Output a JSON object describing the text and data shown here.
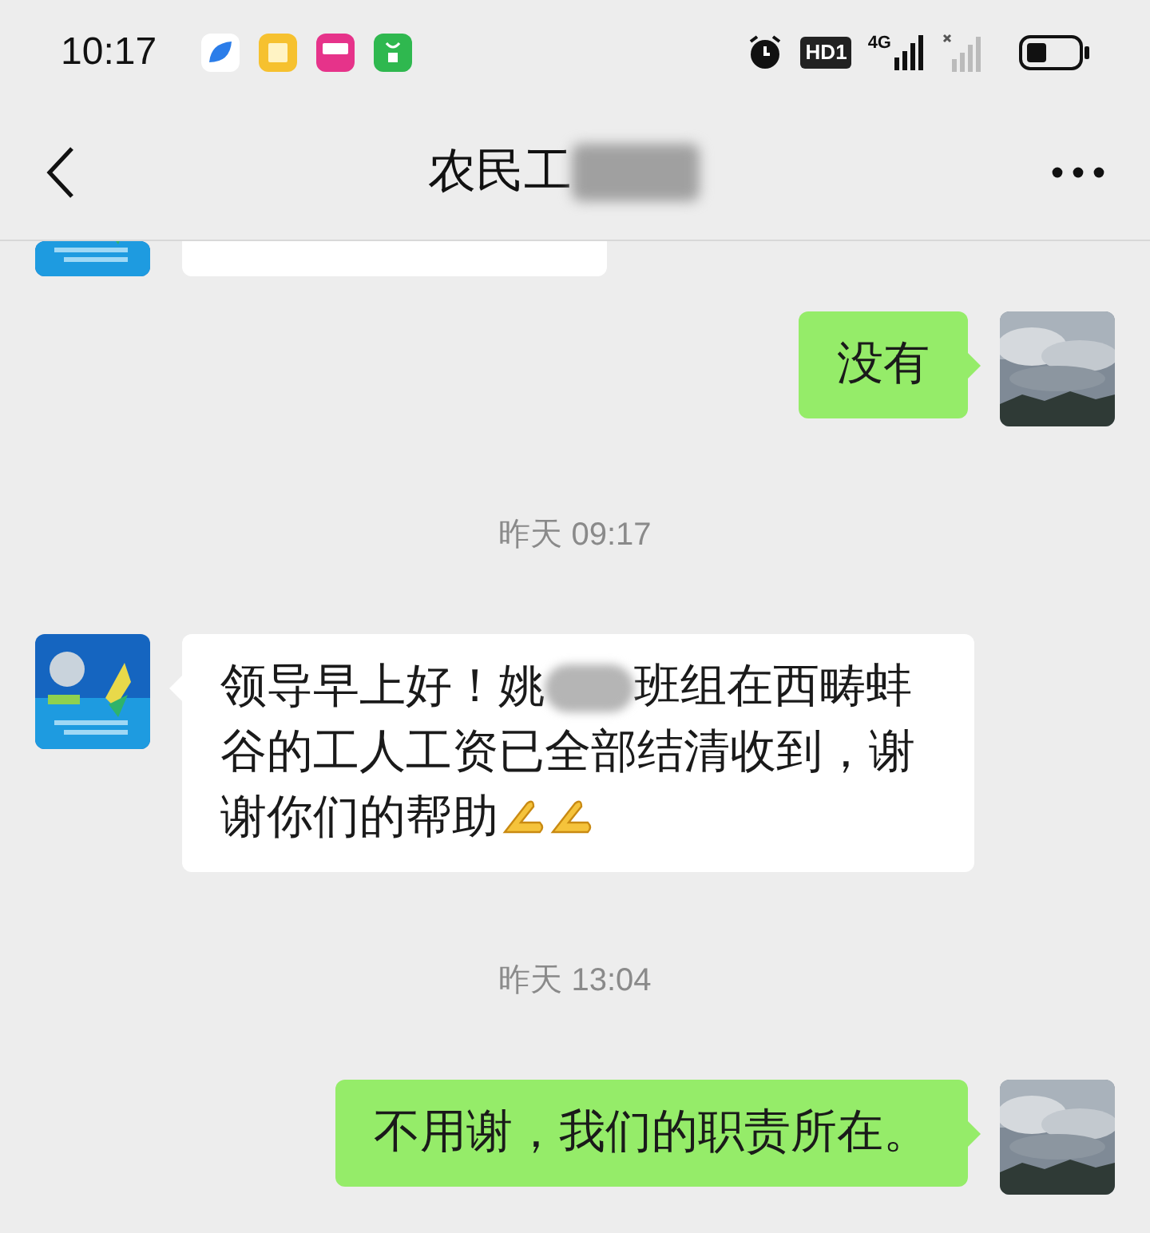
{
  "status_bar": {
    "time": "10:17",
    "hd_label": "HD1",
    "network_label": "4G"
  },
  "header": {
    "title": "农民工",
    "title_blurred": true
  },
  "messages": [
    {
      "kind": "incoming_partial"
    },
    {
      "kind": "outgoing_text",
      "parts": [
        {
          "kind": "text",
          "text": "没有"
        }
      ]
    },
    {
      "kind": "time",
      "text": "昨天 09:17"
    },
    {
      "kind": "incoming_text",
      "parts": [
        {
          "kind": "text",
          "text": "领导早上好！姚"
        },
        {
          "kind": "blur"
        },
        {
          "kind": "text",
          "text": "班组在西畴蚌谷的工人工资已全部结清收到，谢谢你们的帮助"
        },
        {
          "kind": "emoji"
        },
        {
          "kind": "emoji"
        }
      ]
    },
    {
      "kind": "time",
      "text": "昨天 13:04"
    },
    {
      "kind": "outgoing_text",
      "parts": [
        {
          "kind": "text",
          "text": "不用谢，我们的职责所在。"
        }
      ]
    }
  ]
}
